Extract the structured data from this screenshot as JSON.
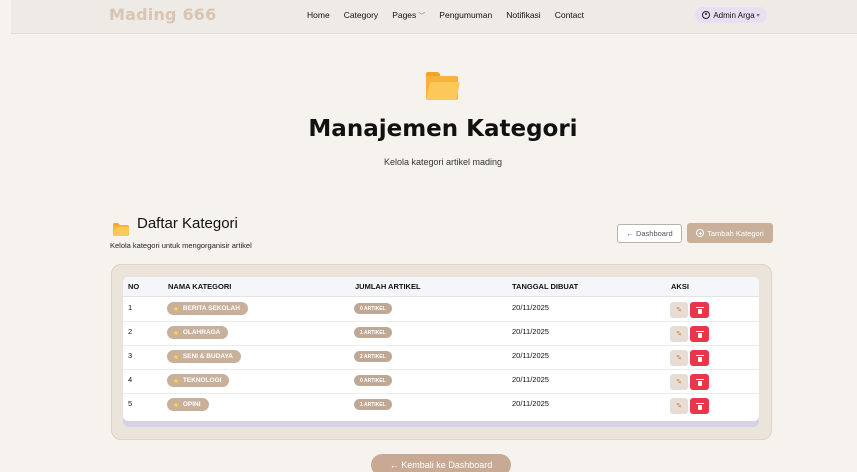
{
  "navbar": {
    "brand": "Mading 666",
    "links": [
      "Home",
      "Category",
      "Pages",
      "Pengumuman",
      "Notifikasi",
      "Contact"
    ],
    "user": "Admin Arga"
  },
  "hero": {
    "icon": "folder-icon",
    "title": "Manajemen Kategori",
    "subtitle": "Kelola kategori artikel mading"
  },
  "section": {
    "icon": "folder-icon",
    "title": "Daftar Kategori",
    "subtitle": "Kelola kategori untuk mengorganisir artikel",
    "dashboard_button": "← Dashboard",
    "add_button": "Tambah Kategori"
  },
  "table": {
    "headers": [
      "NO",
      "NAMA KATEGORI",
      "JUMLAH ARTIKEL",
      "TANGGAL DIBUAT",
      "AKSI"
    ],
    "rows": [
      {
        "no": "1",
        "name": "BERITA SEKOLAH",
        "count": "0 ARTIKEL",
        "date": "20/11/2025"
      },
      {
        "no": "2",
        "name": "OLAHRAGA",
        "count": "1 ARTIKEL",
        "date": "20/11/2025"
      },
      {
        "no": "3",
        "name": "SENI & BUDAYA",
        "count": "2 ARTIKEL",
        "date": "20/11/2025"
      },
      {
        "no": "4",
        "name": "TEKNOLOGI",
        "count": "0 ARTIKEL",
        "date": "20/11/2025"
      },
      {
        "no": "5",
        "name": "OPINI",
        "count": "1 ARTIKEL",
        "date": "20/11/2025"
      }
    ],
    "edit_icon": "pencil-icon",
    "delete_icon": "trash-icon"
  },
  "footer": {
    "back_button": "← Kembali ke Dashboard"
  },
  "colors": {
    "accent": "#c8b09a",
    "danger": "#e8364b",
    "folder": "#f6b33c",
    "background": "#f6f3ef"
  }
}
